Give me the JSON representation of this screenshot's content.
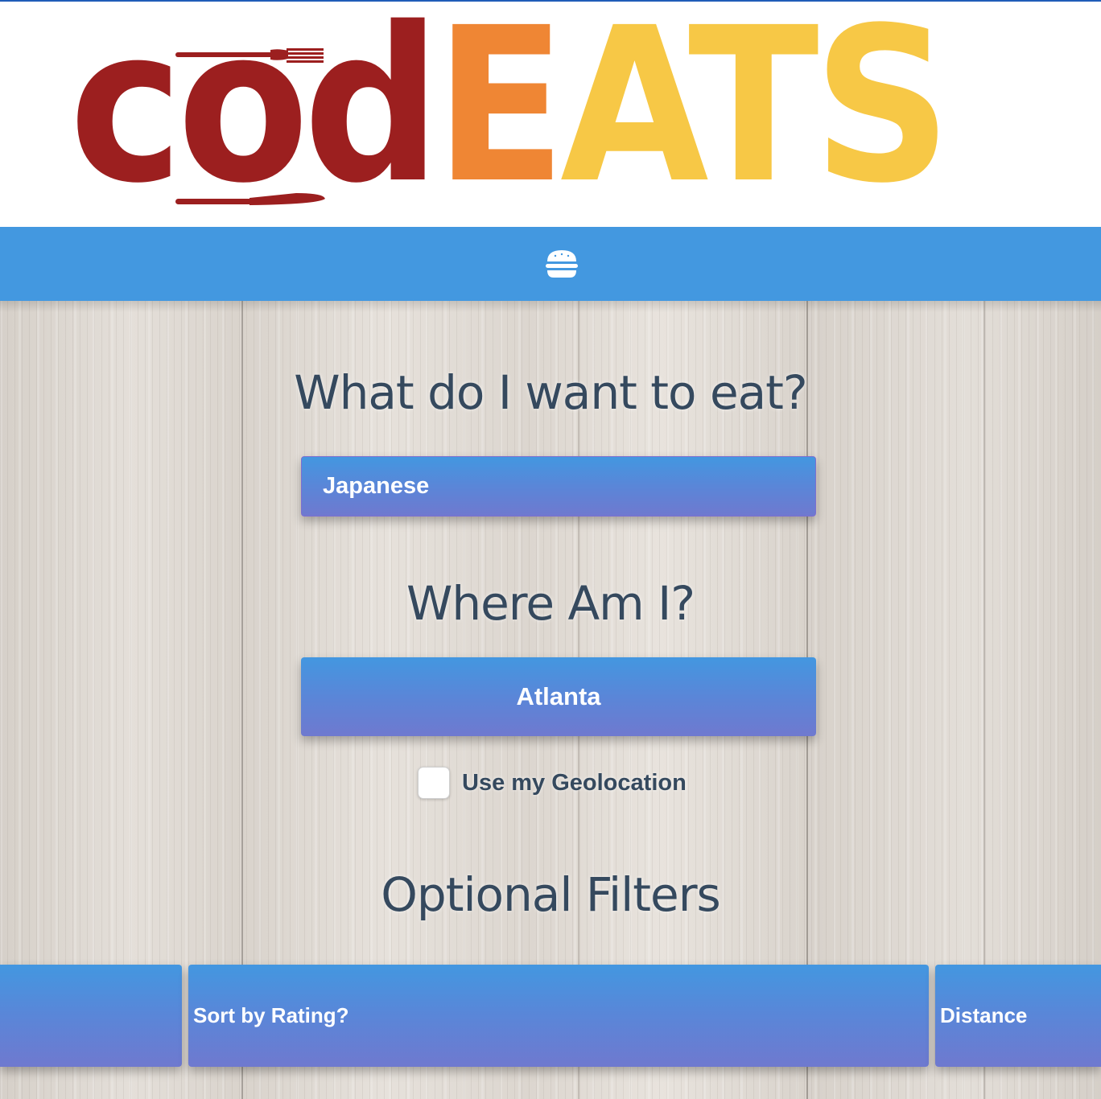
{
  "header": {
    "logo": {
      "part_cod": "cod",
      "part_e": "E",
      "part_ats": "ATS",
      "colors": {
        "cod": "#9c1f1f",
        "e": "#ef8634",
        "ats": "#f7c846"
      }
    }
  },
  "nav": {
    "menu_icon": "hamburger-icon",
    "background": "#4398e0"
  },
  "form": {
    "food_heading": "What do I want to eat?",
    "food_value": "Japanese",
    "location_heading": "Where Am I?",
    "location_value": "Atlanta",
    "geolocation_label": "Use my Geolocation",
    "geolocation_checked": false,
    "filters_heading": "Optional Filters"
  },
  "filters": {
    "left_label": "",
    "rating_label": "Sort by Rating?",
    "distance_label": "Distance"
  }
}
